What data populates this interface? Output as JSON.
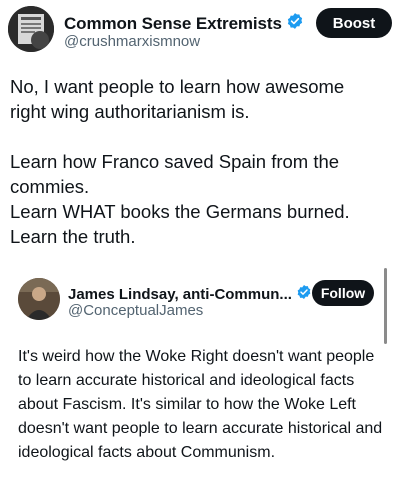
{
  "main_post": {
    "author_name": "Common Sense Extremists",
    "handle": "@crushmarxismnow",
    "boost_label": "Boost",
    "text_lines": [
      "No, I want people to learn how awesome right wing authoritarianism is.",
      "",
      "Learn how Franco saved Spain from the commies.",
      "Learn WHAT books the Germans burned.",
      "Learn the truth."
    ]
  },
  "quoted_post": {
    "author_name": "James Lindsay, anti-Commun...",
    "handle": "@ConceptualJames",
    "follow_label": "Follow",
    "text": "It's weird how the Woke Right doesn't want people to learn accurate historical and ideological facts about Fascism. It's similar to how the Woke Left doesn't want people to learn accurate historical and ideological facts about Communism."
  },
  "colors": {
    "verified": "#1d9bf0",
    "button_bg": "#0f1419",
    "handle": "#536471"
  },
  "icons": [
    "verified-badge-icon"
  ]
}
